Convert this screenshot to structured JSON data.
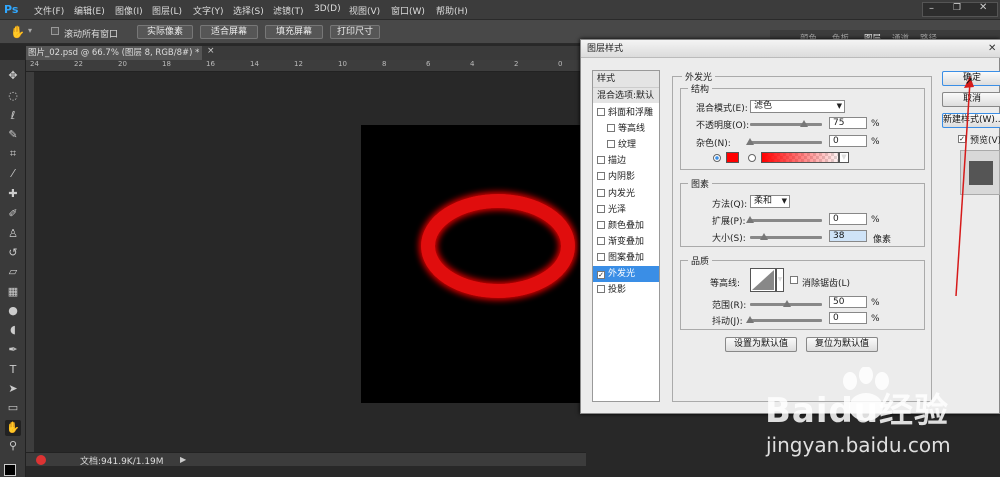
{
  "app": {
    "logo": "Ps"
  },
  "menu": [
    "文件(F)",
    "编辑(E)",
    "图像(I)",
    "图层(L)",
    "文字(Y)",
    "选择(S)",
    "滤镜(T)",
    "3D(D)",
    "视图(V)",
    "窗口(W)",
    "帮助(H)"
  ],
  "options": {
    "scroll_all_label": "滚动所有窗口",
    "buttons": [
      "实际像素",
      "适合屏幕",
      "填充屏幕",
      "打印尺寸"
    ]
  },
  "document": {
    "tab_title": "图片_02.psd @ 66.7% (图层 8, RGB/8#) *",
    "status": "文档:941.9K/1.19M",
    "ruler_h": [
      "24",
      "22",
      "20",
      "18",
      "16",
      "14",
      "12",
      "10",
      "8",
      "6",
      "4",
      "2",
      "0"
    ]
  },
  "right_panel": {
    "tabs": [
      "颜色",
      "色板",
      "图层",
      "通道",
      "路径"
    ]
  },
  "dialog": {
    "title": "图层样式",
    "style_list": {
      "header": "样式",
      "blend": "混合选项:默认",
      "items": [
        {
          "label": "斜面和浮雕",
          "checked": false,
          "indent": false
        },
        {
          "label": "等高线",
          "checked": false,
          "indent": true
        },
        {
          "label": "纹理",
          "checked": false,
          "indent": true
        },
        {
          "label": "描边",
          "checked": false,
          "indent": false
        },
        {
          "label": "内阴影",
          "checked": false,
          "indent": false
        },
        {
          "label": "内发光",
          "checked": false,
          "indent": false
        },
        {
          "label": "光泽",
          "checked": false,
          "indent": false
        },
        {
          "label": "颜色叠加",
          "checked": false,
          "indent": false
        },
        {
          "label": "渐变叠加",
          "checked": false,
          "indent": false
        },
        {
          "label": "图案叠加",
          "checked": false,
          "indent": false
        },
        {
          "label": "外发光",
          "checked": true,
          "indent": false
        },
        {
          "label": "投影",
          "checked": false,
          "indent": false
        }
      ]
    },
    "outer_glow": {
      "title": "外发光",
      "structure": {
        "title": "结构",
        "blend_mode_label": "混合模式(E):",
        "blend_mode": "滤色",
        "opacity_label": "不透明度(O):",
        "opacity": "75",
        "opacity_level": 0.75,
        "noise_label": "杂色(N):",
        "noise": "0",
        "noise_level": 0,
        "glow_color": "#ff0000"
      },
      "elements": {
        "title": "图素",
        "technique_label": "方法(Q):",
        "technique": "柔和",
        "spread_label": "扩展(P):",
        "spread": "0",
        "spread_level": 0,
        "size_label": "大小(S):",
        "size": "38",
        "size_unit": "像素",
        "size_level": 0.15
      },
      "quality": {
        "title": "品质",
        "contour_label": "等高线:",
        "anti_alias_label": "消除锯齿(L)",
        "range_label": "范围(R):",
        "range": "50",
        "range_level": 0.5,
        "jitter_label": "抖动(J):",
        "jitter": "0",
        "jitter_level": 0
      },
      "percent": "%",
      "make_default": "设置为默认值",
      "reset_default": "复位为默认值"
    },
    "buttons": {
      "ok": "确定",
      "cancel": "取消",
      "new_style": "新建样式(W)...",
      "preview": "预览(V)"
    }
  },
  "watermark": {
    "brand": "Baidu经验",
    "url": "jingyan.baidu.com"
  },
  "colors": {
    "accent": "#3a8ee6",
    "glow": "#e01010"
  }
}
